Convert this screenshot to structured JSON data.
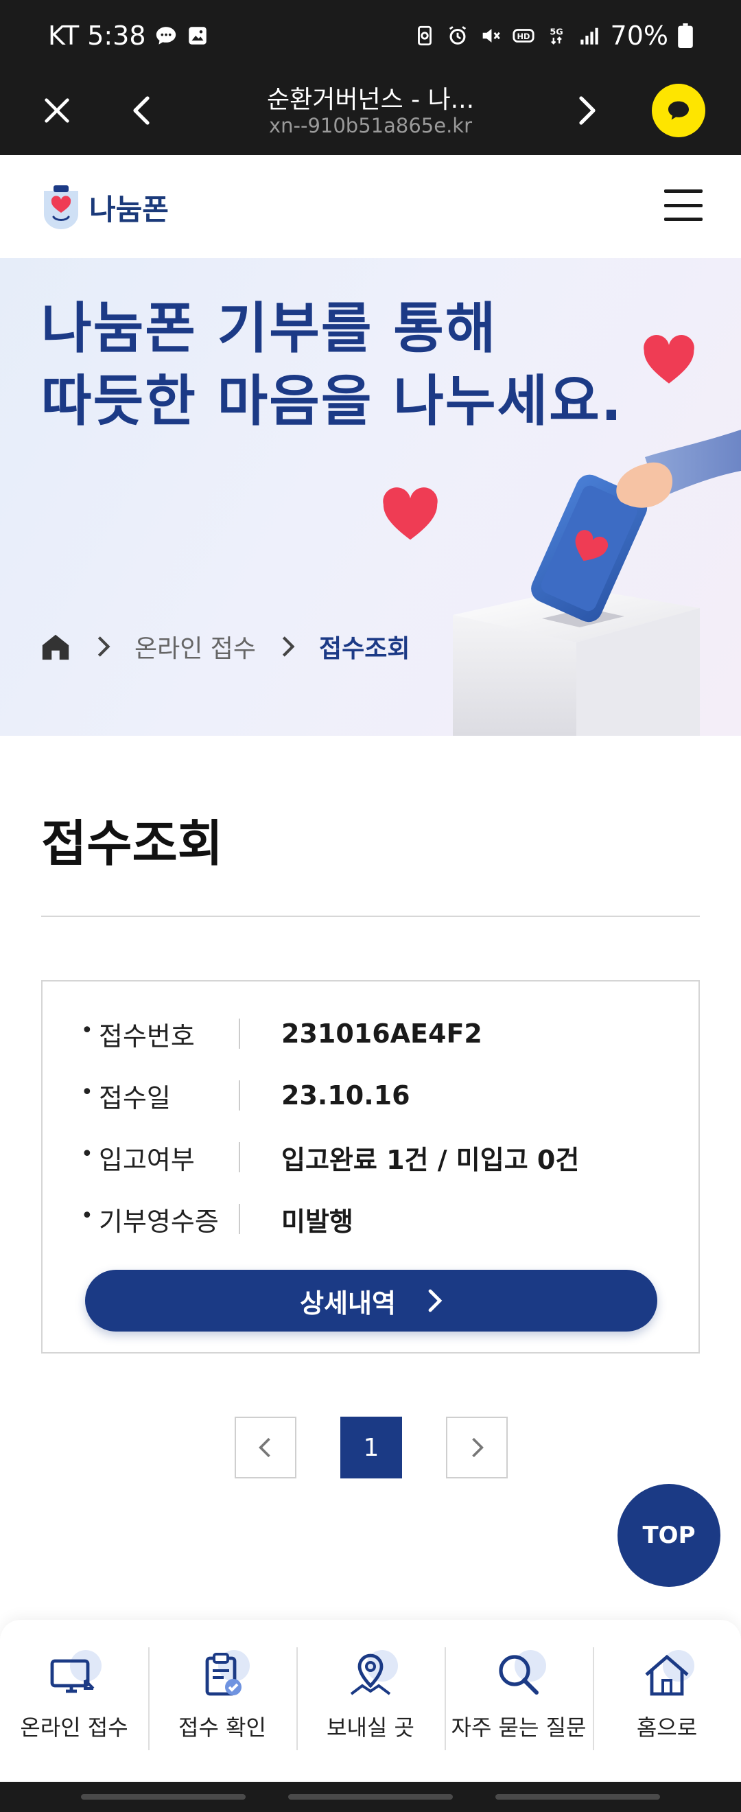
{
  "status_bar": {
    "carrier": "KT",
    "time": "5:38",
    "battery": "70%"
  },
  "browser": {
    "title": "순환거버넌스 - 나...",
    "url": "xn--910b51a865e.kr"
  },
  "site": {
    "logo_text": "나눔폰"
  },
  "hero": {
    "line1": "나눔폰 기부를 통해",
    "line2": "따듯한 마음을 나누세요.",
    "breadcrumb": {
      "level1": "온라인 접수",
      "current": "접수조회"
    }
  },
  "page": {
    "title": "접수조회"
  },
  "receipt": {
    "rows": [
      {
        "label": "접수번호",
        "value": "231016AE4F2"
      },
      {
        "label": "접수일",
        "value": "23.10.16"
      },
      {
        "label": "입고여부",
        "value": "입고완료 1건 / 미입고 0건"
      },
      {
        "label": "기부영수증",
        "value": "미발행"
      }
    ],
    "detail_button": "상세내역"
  },
  "pagination": {
    "current_page": "1"
  },
  "top_button": "TOP",
  "bottom_nav": [
    {
      "label": "온라인 접수",
      "icon": "monitor-icon"
    },
    {
      "label": "접수 확인",
      "icon": "clipboard-check-icon"
    },
    {
      "label": "보내실 곳",
      "icon": "map-pin-icon"
    },
    {
      "label": "자주 묻는 질문",
      "icon": "search-icon"
    },
    {
      "label": "홈으로",
      "icon": "home-icon"
    }
  ],
  "colors": {
    "brand_navy": "#1b3a85",
    "hero_text": "#1c3a86",
    "kakao_yellow": "#fee500",
    "heart_red": "#ef3c54"
  }
}
